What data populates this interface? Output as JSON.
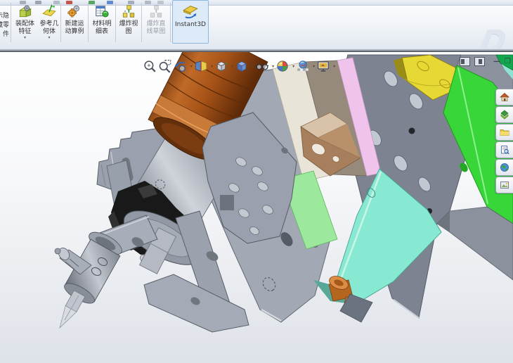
{
  "window": {
    "watermark": "D"
  },
  "toolbar": {
    "buttons": [
      {
        "id": "show-hide-components",
        "lines": "显示隐\n藏零\n件"
      },
      {
        "id": "assembly-features",
        "line1": "装配体",
        "line2": "特征",
        "caret": "▾"
      },
      {
        "id": "reference-geometry",
        "line1": "参考几",
        "line2": "何体",
        "caret": "▾"
      },
      {
        "id": "new-motion-study",
        "line1": "新建运",
        "line2": "动算例"
      },
      {
        "id": "bill-of-materials",
        "line1": "材料明",
        "line2": "细表"
      },
      {
        "id": "exploded-view",
        "line1": "爆炸视",
        "line2": "图"
      },
      {
        "id": "explode-line-sketch",
        "line1": "爆炸直",
        "line2": "线草图"
      },
      {
        "id": "instant3d",
        "label": "Instant3D"
      }
    ]
  },
  "hud_toolbar": {
    "icons": [
      "zoom-to-fit",
      "zoom-to-area",
      "previous-view",
      "section-view",
      "view-orientation",
      "display-style",
      "hide-show-items",
      "edit-appearance",
      "apply-scene",
      "view-settings"
    ]
  },
  "window_controls": {
    "minimize": "—",
    "restore": "❐",
    "close": "✕"
  },
  "task_pane": {
    "icons": [
      "solidworks-resources",
      "design-library",
      "file-explorer",
      "search",
      "view-palette",
      "appearances"
    ]
  },
  "model": {
    "parts": [
      "motor-cylinder",
      "spindle-housing",
      "clamp-collar",
      "flange-disc",
      "drill-chuck",
      "drill-bit",
      "chuck-knob",
      "upper-bracket",
      "fork-bracket",
      "motor-bracket",
      "base-plate",
      "slab-plate",
      "green-plate",
      "cyan-plate",
      "pink-plate",
      "cream-plate",
      "taupe-plate",
      "tan-block",
      "yellow-block",
      "light-green-plate",
      "orange-bushing"
    ],
    "colors": {
      "motor_body": "#a85a22",
      "motor_dark": "#6b3208",
      "copper_band": "#c87a38",
      "spindle": "#a8aeb9",
      "black_clamp": "#191919",
      "gray_plate": "#a2a8b4",
      "bracket_gray": "#9aa0ad",
      "dark_slab": "#7d8390",
      "rail_gray": "#8b919d",
      "green_plate": "#38d638",
      "emerald": "#12a74e",
      "teal_sliver": "#8fe2d2",
      "cyan_plate": "#87e9d1",
      "cyan_edge": "#58a897",
      "pink_plate": "#efc3eb",
      "cream_plate": "#e9e4d8",
      "taupe_plate": "#968a7c",
      "tan_block": "#a87f5c",
      "tan_top": "#d8c3a8",
      "yellow_block": "#e6d835",
      "light_green": "#9ce89c",
      "orange_bushing": "#b4661e",
      "orange_top": "#dd8c46"
    }
  }
}
